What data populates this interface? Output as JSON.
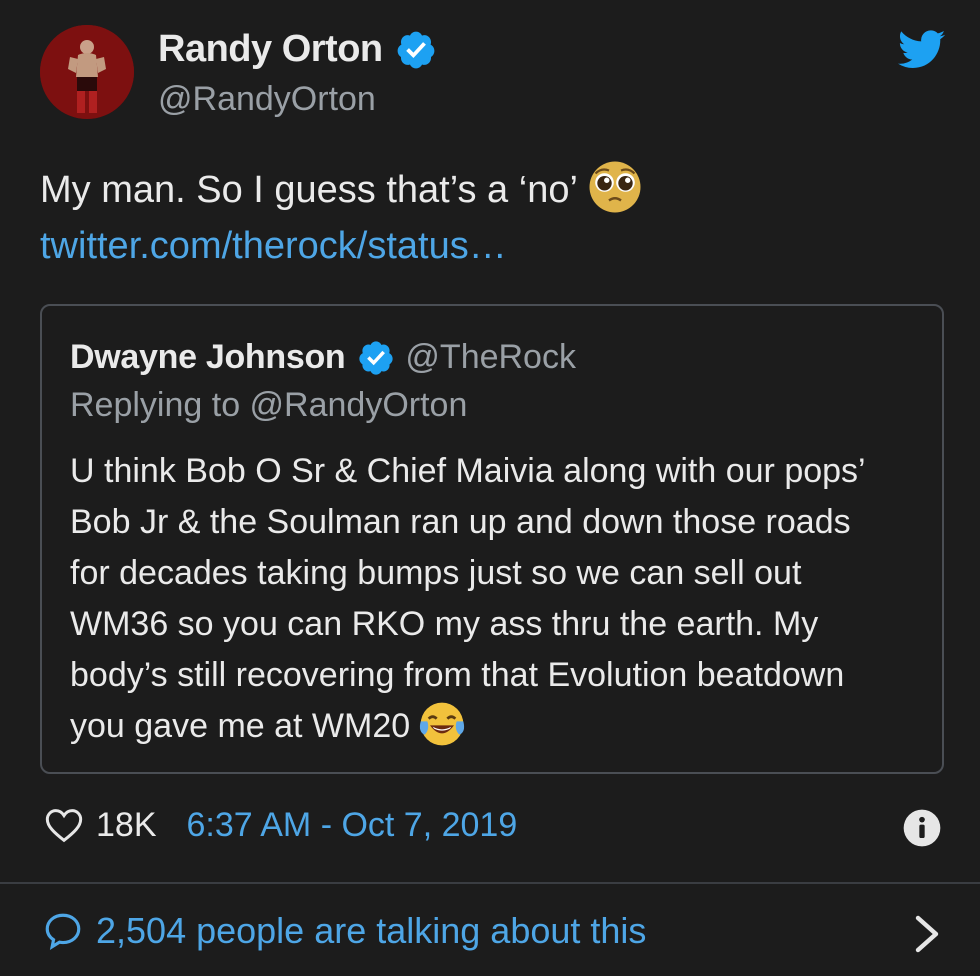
{
  "author": {
    "name": "Randy Orton",
    "handle": "@RandyOrton",
    "verified": true,
    "avatar_icon": "avatar-wrestler"
  },
  "brand": {
    "icon": "twitter-bird-icon",
    "color": "#1da1f2"
  },
  "tweet": {
    "text": "My man. So I guess that’s a ‘no’",
    "emoji": "pleading-face",
    "link": "twitter.com/therock/status…"
  },
  "quoted": {
    "name": "Dwayne Johnson",
    "handle": "@TheRock",
    "verified": true,
    "replying_to": "Replying to @RandyOrton",
    "lines": [
      "U think Bob O Sr & Chief Maivia along with our pops’",
      "Bob Jr & the Soulman ran up and down those roads",
      "for decades taking bumps just so we can sell out",
      "WM36 so you can RKO my ass thru the earth. My",
      "body’s still recovering from that Evolution beatdown",
      "you gave me at WM20"
    ],
    "trailing_emoji": "tears-of-joy"
  },
  "meta": {
    "likes": "18K",
    "timestamp": "6:37 AM - Oct 7, 2019"
  },
  "footer": {
    "talking": "2,504 people are talking about this"
  },
  "colors": {
    "background": "#1c1c1c",
    "link": "#4ea6e6",
    "verified": "#1da1f2",
    "muted": "#9aa0a6"
  }
}
